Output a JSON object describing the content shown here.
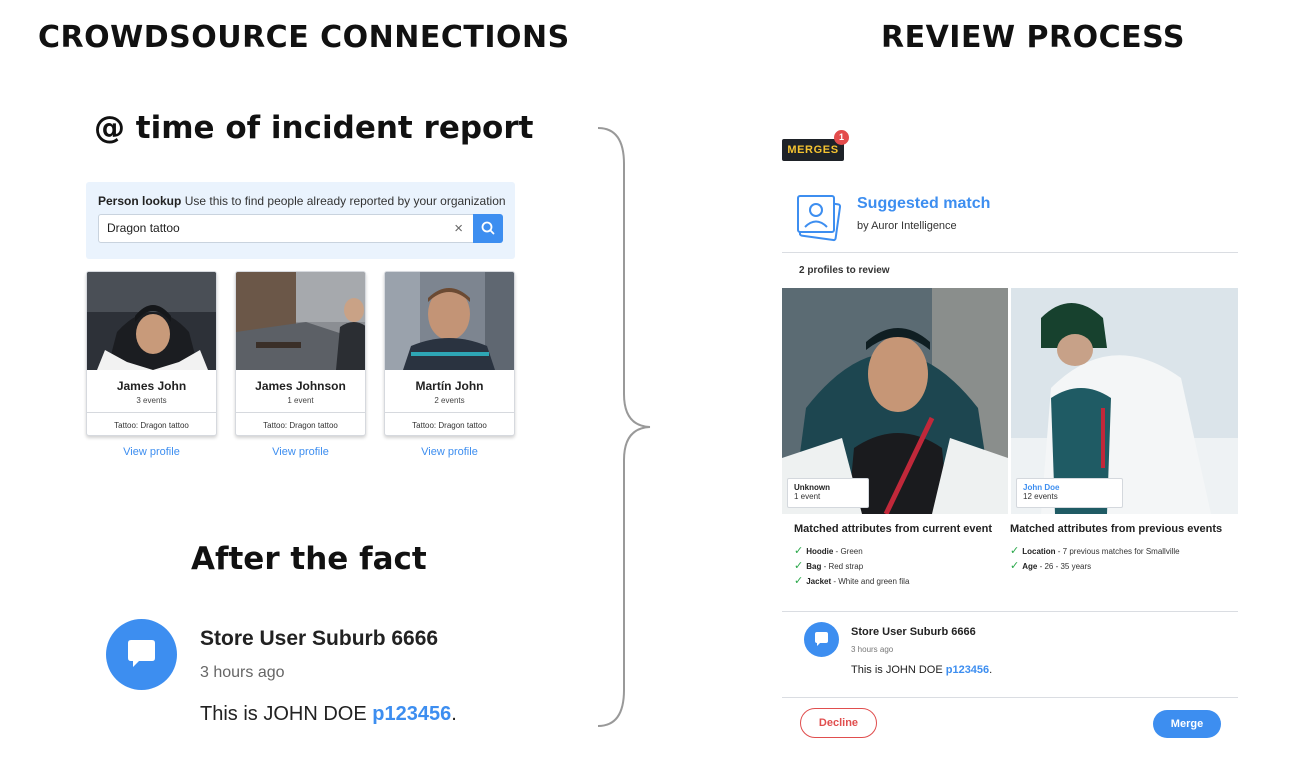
{
  "headings": {
    "left": "CROWDSOURCE CONNECTIONS",
    "right": "REVIEW PROCESS",
    "incident": "@ time of incident report",
    "after": "After the fact"
  },
  "lookup": {
    "label_bold": "Person lookup",
    "label_rest": "Use this to find people already reported by your organization",
    "value": "Dragon tattoo",
    "clear_symbol": "×"
  },
  "people": [
    {
      "name": "James John",
      "events": "3 events",
      "attr": "Tattoo: Dragon tattoo",
      "link": "View profile"
    },
    {
      "name": "James Johnson",
      "events": "1 event",
      "attr": "Tattoo: Dragon tattoo",
      "link": "View profile"
    },
    {
      "name": "Martín John",
      "events": "2 events",
      "attr": "Tattoo: Dragon tattoo",
      "link": "View profile"
    }
  ],
  "comment": {
    "author": "Store User Suburb 6666",
    "time": "3 hours ago",
    "text_prefix": "This is JOHN DOE ",
    "ref": "p123456",
    "text_suffix": "."
  },
  "review": {
    "tab_label": "MERGES",
    "tab_badge": "1",
    "title": "Suggested match",
    "by": "by Auror Intelligence",
    "profiles_count": "2 profiles to review",
    "profiles": [
      {
        "name": "Unknown",
        "events": "1 event"
      },
      {
        "name": "John Doe",
        "events": "12 events"
      }
    ],
    "current": {
      "heading": "Matched attributes from current event",
      "items": [
        {
          "key": "Hoodie",
          "value": " - Green"
        },
        {
          "key": "Bag",
          "value": " - Red strap"
        },
        {
          "key": "Jacket",
          "value": " - White and green fila"
        }
      ]
    },
    "previous": {
      "heading": "Matched attributes from previous events",
      "items": [
        {
          "key": "Location",
          "value": " - 7 previous matches for Smallville"
        },
        {
          "key": "Age",
          "value": " - 26 - 35 years"
        }
      ]
    },
    "decline_label": "Decline",
    "merge_label": "Merge"
  },
  "colors": {
    "accent": "#3d8ef0",
    "danger": "#e04e4e",
    "success": "#2aa84a",
    "merges_tab": "#1e2228",
    "merges_text": "#f5c431"
  }
}
